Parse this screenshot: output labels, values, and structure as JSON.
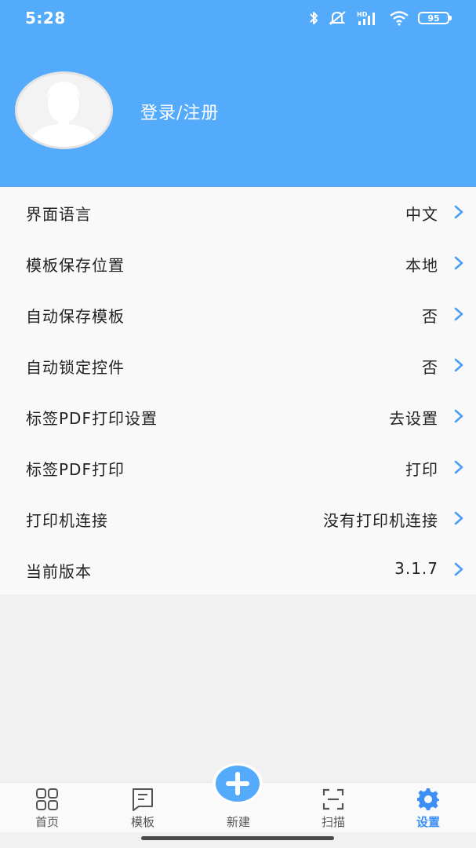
{
  "status_bar": {
    "time": "5:28",
    "icons": [
      "bluetooth-icon",
      "mute-icon",
      "signal-icon",
      "wifi-icon"
    ],
    "network_badge": "HD",
    "battery": "95"
  },
  "profile": {
    "login_label": "登录/注册"
  },
  "settings": [
    {
      "label": "界面语言",
      "value": "中文"
    },
    {
      "label": "模板保存位置",
      "value": "本地"
    },
    {
      "label": "自动保存模板",
      "value": "否"
    },
    {
      "label": "自动锁定控件",
      "value": "否"
    },
    {
      "label": "标签PDF打印设置",
      "value": "去设置"
    },
    {
      "label": "标签PDF打印",
      "value": "打印"
    },
    {
      "label": "打印机连接",
      "value": "没有打印机连接"
    },
    {
      "label": "当前版本",
      "value": "3.1.7"
    }
  ],
  "nav": {
    "home": "首页",
    "templates": "模板",
    "new": "新建",
    "scan": "扫描",
    "settings": "设置",
    "active": "settings"
  },
  "colors": {
    "accent": "#55abfb",
    "active_tab": "#3d8ff5",
    "chevron": "#4a9ff5"
  }
}
